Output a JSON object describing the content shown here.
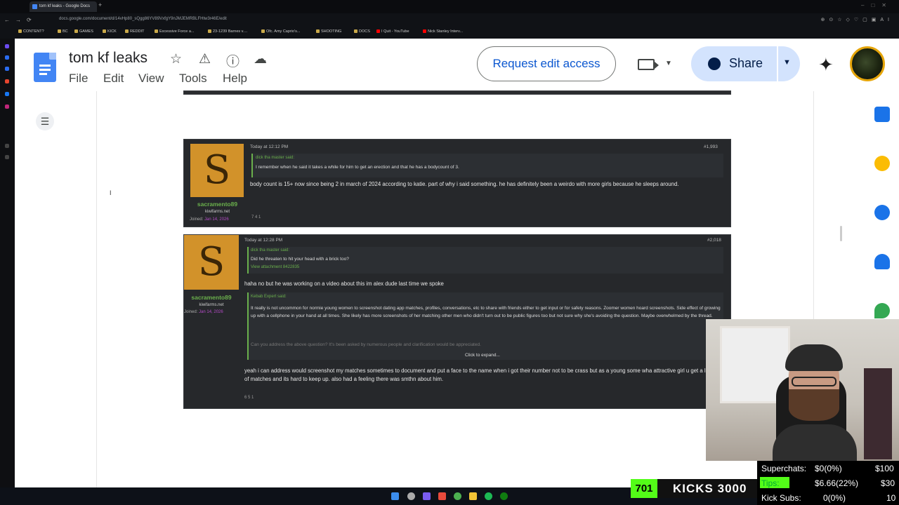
{
  "browser": {
    "tab_title": "tom kf leaks - Google Docs",
    "url": "docs.google.com/document/d/14vHp80_sQgg86YV89VxfgY9nJMJEMRBLFHtw3r46E/edit",
    "bookmarks": [
      "CONTENT?",
      "BC",
      "GAMES",
      "KICK",
      "REDDIT",
      "Excessive Force a...",
      "23-1239 Barnes v....",
      "Ofc. Amy Caprio's...",
      "SHOOTING",
      "DOCS",
      "I Quit - YouTube",
      "Nick Stanley Interv..."
    ]
  },
  "docs": {
    "title": "tom kf leaks",
    "menu": [
      "File",
      "Edit",
      "View",
      "Tools",
      "Help"
    ],
    "request_edit": "Request edit access",
    "share": "Share"
  },
  "posts": [
    {
      "username": "sacramento89",
      "avatar_letter": "S",
      "site": "kiwifarms.net",
      "joined_label": "Joined:",
      "joined_date": "Jan 14, 2026",
      "time": "Today at 12:12 PM",
      "post_number": "#1,993",
      "quote_author": "dick tha master said:",
      "quote_text": "I remember when he said it takes a while for him to get an erection and that he has a bodycount of 3.",
      "body": "body count is 15+ now since being 2 in march of 2024 according to katie. part of why i said something. he has definitely been a weirdo with more girls because he sleeps around.",
      "reactions": "7   4   1"
    },
    {
      "username": "sacramento89",
      "avatar_letter": "S",
      "site": "kiwifarms.net",
      "joined_label": "Joined:",
      "joined_date": "Jan 14, 2026",
      "time": "Today at 12:28 PM",
      "post_number": "#2,018",
      "quote_author": "dick tha master said:",
      "quote_text": "Did he threaten to hit your head with a brick too?",
      "quote_attachment": "View attachment 8422835",
      "body1": "haha no but he was working on a video about this im alex dude last time we spoke",
      "quote2_author": "Kebab Expert said:",
      "quote2_text": "It really is not uncommon for normie young women to screenshot dating app matches, profiles, conversations, etc to share with friends either to get input or for safety reasons. Zoomer women hoard screenshots. Side effect of growing up with a cellphone in your hand at all times. She likely has more screenshots of her matching other men who didn't turn out to be public figures too but not sure why she's avoiding the question. Maybe overwhelmed by the thread.",
      "quote2_more": "Can you address the above question? It's been asked by numerous people and clarification would be appreciated.",
      "expand": "Click to expand...",
      "body2": "yeah i can address would screenshot my matches sometimes to document and put a face to the name when i got their number not to be crass but as a young some wha attractive girl u get a lot of matches and its hard to keep up. also had a feeling there was smthn about him.",
      "reactions": "6   5   1"
    }
  ],
  "stream": {
    "kicks_count": "701",
    "kicks_label": "KICKS  3000",
    "superchats_label": "Superchats:",
    "superchats_value": "$0(0%)",
    "superchats_goal": "$100",
    "tips_label": "Tips:",
    "tips_value": "$6.66(22%)",
    "tips_goal": "$30",
    "kicksubs_label": "Kick Subs:",
    "kicksubs_value": "0(0%)",
    "kicksubs_goal": "10"
  },
  "colors": {
    "docs_blue": "#4285f4",
    "kick_green": "#53fc18",
    "username_green": "#6ab04c",
    "avatar_orange": "#d2922a"
  }
}
